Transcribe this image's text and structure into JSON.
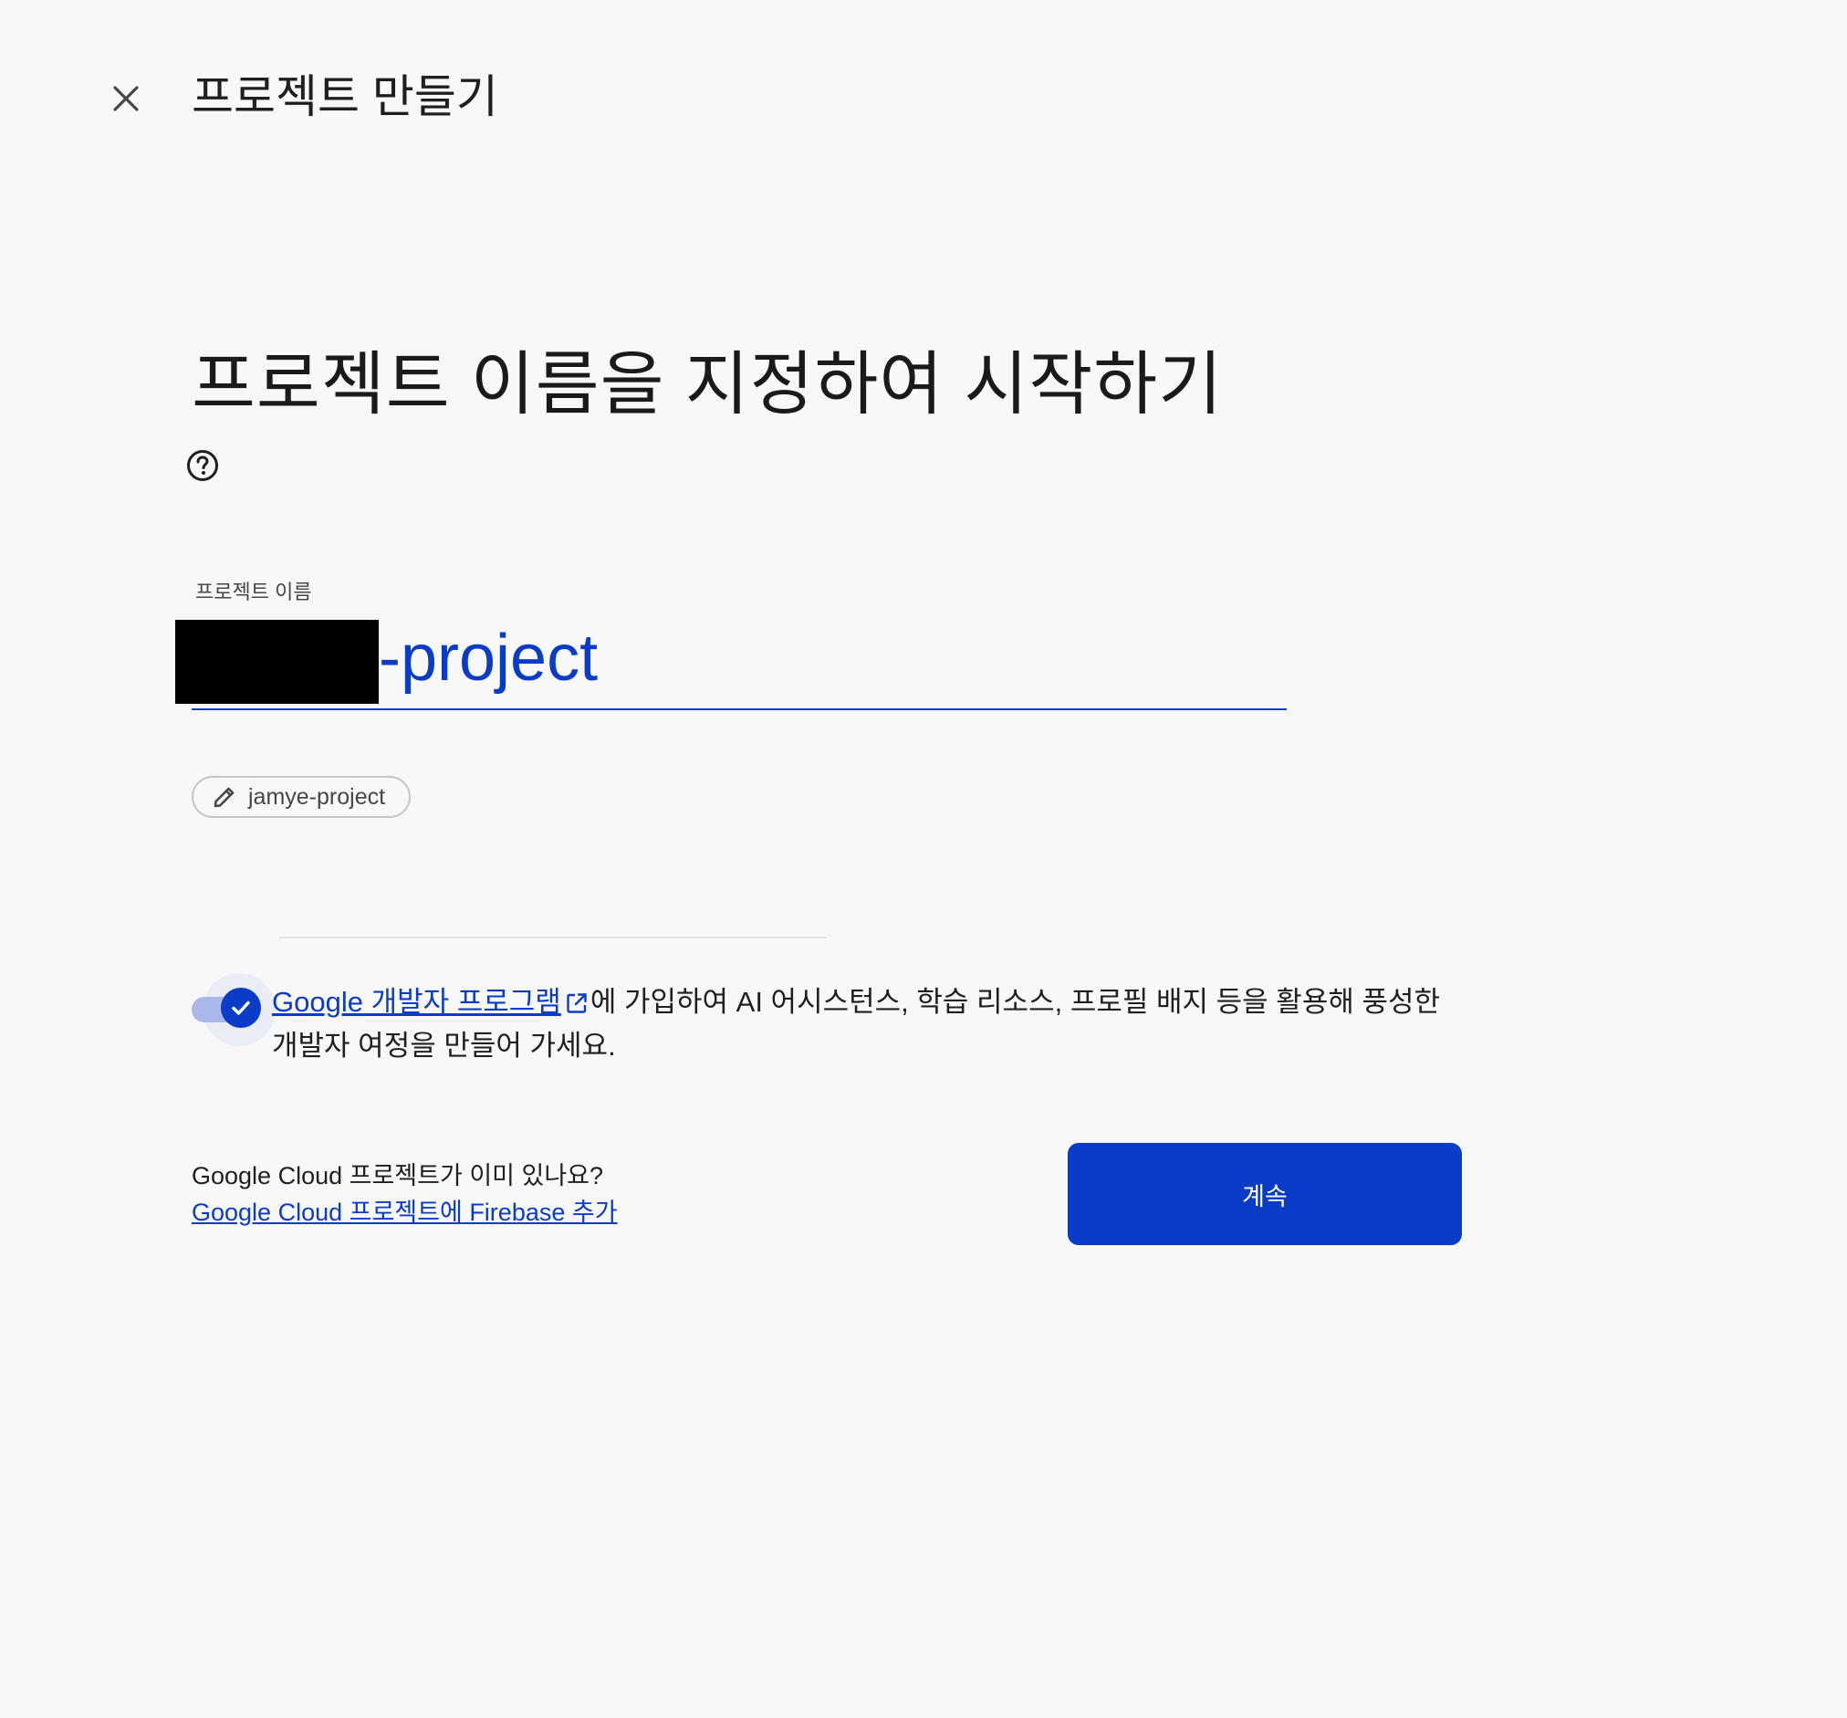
{
  "header": {
    "title": "프로젝트 만들기"
  },
  "hero": {
    "title": "프로젝트 이름을 지정하여 시작하기"
  },
  "project_name_field": {
    "label": "프로젝트 이름",
    "value_suffix": "-project"
  },
  "project_id_chip": {
    "value": "jamye-project"
  },
  "developer_program": {
    "enabled": true,
    "link_text": "Google 개발자 프로그램",
    "description": "에 가입하여 AI 어시스턴스, 학습 리소스, 프로필 배지 등을 활용해 풍성한 개발자 여정을 만들어 가세요."
  },
  "footer": {
    "question": "Google Cloud 프로젝트가 이미 있나요?",
    "link_text": "Google Cloud 프로젝트에 Firebase 추가",
    "continue_label": "계속"
  },
  "colors": {
    "accent": "#0b3cc8",
    "background": "#f8f8f8"
  },
  "icons": {
    "close": "close-icon",
    "help": "help-circle-icon",
    "edit": "pencil-icon",
    "external_link": "external-link-icon",
    "check": "check-icon"
  }
}
